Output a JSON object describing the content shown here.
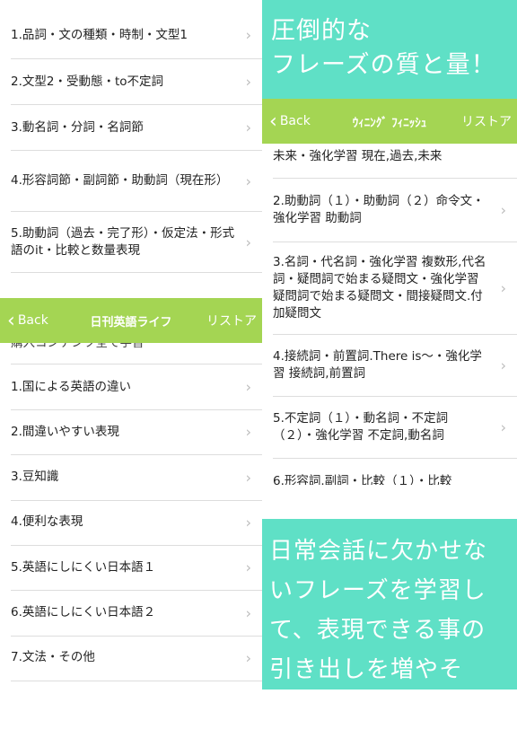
{
  "left_top": {
    "items": [
      "1.品詞・文の種類・時制・文型1",
      "2.文型2・受動態・to不定詞",
      "3.動名詞・分詞・名詞節",
      "4.形容詞節・副詞節・助動詞（現在形）",
      "5.助動詞（過去・完了形）・仮定法・形式語のit・比較と数量表現"
    ]
  },
  "left_bottom": {
    "nav": {
      "back": "Back",
      "title": "日刊英語ライフ",
      "right": "リストア"
    },
    "partial": "購入コンテンツ全て学習",
    "items": [
      "1.国による英語の違い",
      "2.間違いやすい表現",
      "3.豆知識",
      "4.便利な表現",
      "5.英語にしにくい日本語１",
      "6.英語にしにくい日本語２",
      "7.文法・その他"
    ]
  },
  "right": {
    "nav": {
      "back": "Back",
      "title": "ｳｨﾆﾝｸﾞ ﾌｨﾆｯｼｭ",
      "right": "リストア"
    },
    "partial_top": "未来・強化学習 現在,過去,未来",
    "items": [
      "2.助動詞（１）・助動詞（２）命令文・強化学習 助動詞",
      "3.名詞・代名詞・強化学習 複数形,代名詞・疑問詞で始まる疑問文・強化学習 疑問詞で始まる疑問文・間接疑問文.付加疑問文",
      "4.接続詞・前置詞.There is〜・強化学習 接続詞,前置詞",
      "5.不定詞（１）・動名詞・不定詞（２）・強化学習 不定詞,動名詞"
    ],
    "partial_bottom": "6.形容詞.副詞・比較（１）・比較"
  },
  "promo_top": "圧倒的な\nフレーズの質と量！",
  "promo_bottom": "日常会話に欠かせないフレーズを学習して、表現できる事の引き出しを増やそう！",
  "colors": {
    "nav": "#a4d553",
    "promo": "#5fe0c6"
  },
  "icons": {
    "chevron": "chevron-right-icon",
    "back": "chevron-left-icon"
  }
}
